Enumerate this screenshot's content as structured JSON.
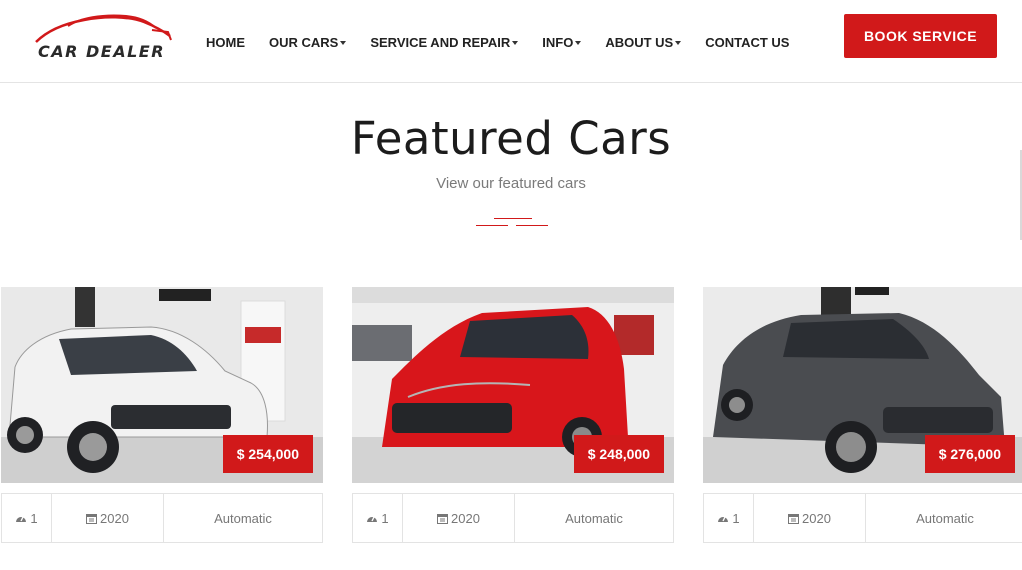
{
  "brand": {
    "logo_text": "CAR DEALER",
    "accent": "#d1191a"
  },
  "nav": {
    "items": [
      {
        "label": "HOME",
        "dropdown": false
      },
      {
        "label": "OUR CARS",
        "dropdown": true
      },
      {
        "label": "SERVICE AND REPAIR",
        "dropdown": true
      },
      {
        "label": "INFO",
        "dropdown": true
      },
      {
        "label": "ABOUT US",
        "dropdown": true
      },
      {
        "label": "CONTACT US",
        "dropdown": false
      }
    ],
    "cta_label": "BOOK SERVICE"
  },
  "section": {
    "title": "Featured Cars",
    "subtitle": "View our featured cars"
  },
  "cars": [
    {
      "color": "#f2f2f2",
      "price": "$ 254,000",
      "owners": "1",
      "year": "2020",
      "transmission": "Automatic",
      "icons": [
        "tachometer-icon",
        "calendar-icon"
      ]
    },
    {
      "color": "#d8161b",
      "price": "$ 248,000",
      "owners": "1",
      "year": "2020",
      "transmission": "Automatic",
      "icons": [
        "tachometer-icon",
        "calendar-icon"
      ]
    },
    {
      "color": "#4a4c50",
      "price": "$ 276,000",
      "owners": "1",
      "year": "2020",
      "transmission": "Automatic",
      "icons": [
        "tachometer-icon",
        "calendar-icon"
      ]
    }
  ]
}
